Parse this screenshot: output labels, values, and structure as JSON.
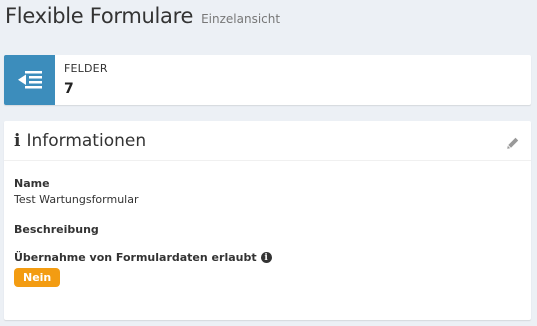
{
  "header": {
    "title": "Flexible Formulare",
    "subtitle": "Einzelansicht"
  },
  "info_box": {
    "icon": "list-indent-icon",
    "icon_bg": "#3c8dbc",
    "label": "FELDER",
    "value": "7"
  },
  "panel": {
    "title": "Informationen",
    "title_icon": "info-icon",
    "edit_icon": "pencil-icon",
    "fields": {
      "name_label": "Name",
      "name_value": "Test Wartungsformular",
      "description_label": "Beschreibung",
      "takeover_label": "Übernahme von Formulardaten erlaubt",
      "takeover_value": "Nein",
      "takeover_badge_color": "#f39c12"
    }
  }
}
